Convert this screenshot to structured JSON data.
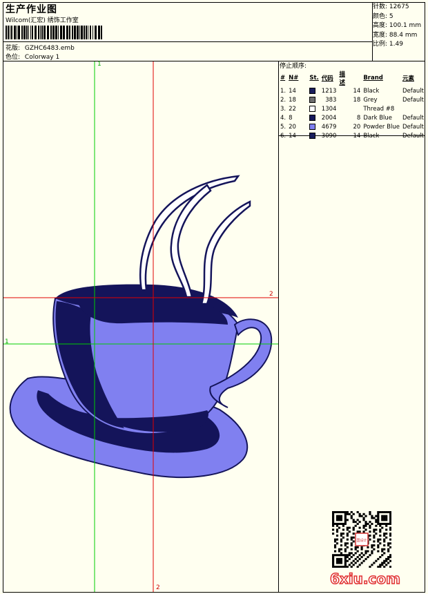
{
  "header": {
    "title": "生产作业图",
    "company": "Wilcom(汇宏) 绣饰工作室",
    "pattern_label": "花版:",
    "pattern_value": "GZHC6483.emb",
    "color_label": "色位:",
    "color_value": "Colorway 1"
  },
  "stats": [
    {
      "label": "针数:",
      "value": "12675"
    },
    {
      "label": "颜色:",
      "value": "5"
    },
    {
      "label": "高度:",
      "value": "100.1 mm"
    },
    {
      "label": "宽度:",
      "value": "88.4 mm"
    },
    {
      "label": "比例:",
      "value": "1.49"
    }
  ],
  "stop_sequence": {
    "title": "停止顺序:",
    "headers": [
      "#",
      "N#",
      "St.",
      "代码",
      "描述",
      "Brand",
      "元素"
    ],
    "rows": [
      {
        "idx": "1.",
        "n": "14",
        "color": "#1a1f5c",
        "st": "1213",
        "code": "14",
        "desc": "Black",
        "brand": "Default"
      },
      {
        "idx": "2.",
        "n": "18",
        "color": "#6e6e6e",
        "st": "383",
        "code": "18",
        "desc": "Grey",
        "brand": "Default"
      },
      {
        "idx": "3.",
        "n": "22",
        "color": "#ffffff",
        "st": "1304",
        "code": "",
        "desc": "Thread #8",
        "brand": ""
      },
      {
        "idx": "4.",
        "n": "8",
        "color": "#15185a",
        "st": "2004",
        "code": "8",
        "desc": "Dark Blue",
        "brand": "Default"
      },
      {
        "idx": "5.",
        "n": "20",
        "color": "#8080f0",
        "st": "4679",
        "code": "20",
        "desc": "Powder Blue",
        "brand": "Default"
      },
      {
        "idx": "6.",
        "n": "14",
        "color": "#1a1f5c",
        "st": "3090",
        "code": "14",
        "desc": "Black",
        "brand": "Default"
      }
    ]
  },
  "guides": {
    "v1": "1",
    "h1": "1",
    "h2": "2",
    "v2": "2"
  },
  "colors": {
    "dark": "#14145a",
    "powder": "#8080f0",
    "guide_green": "#00cc00",
    "guide_red": "#e00000"
  },
  "watermark": "6xiu.com",
  "qr_stamp": "国设计"
}
